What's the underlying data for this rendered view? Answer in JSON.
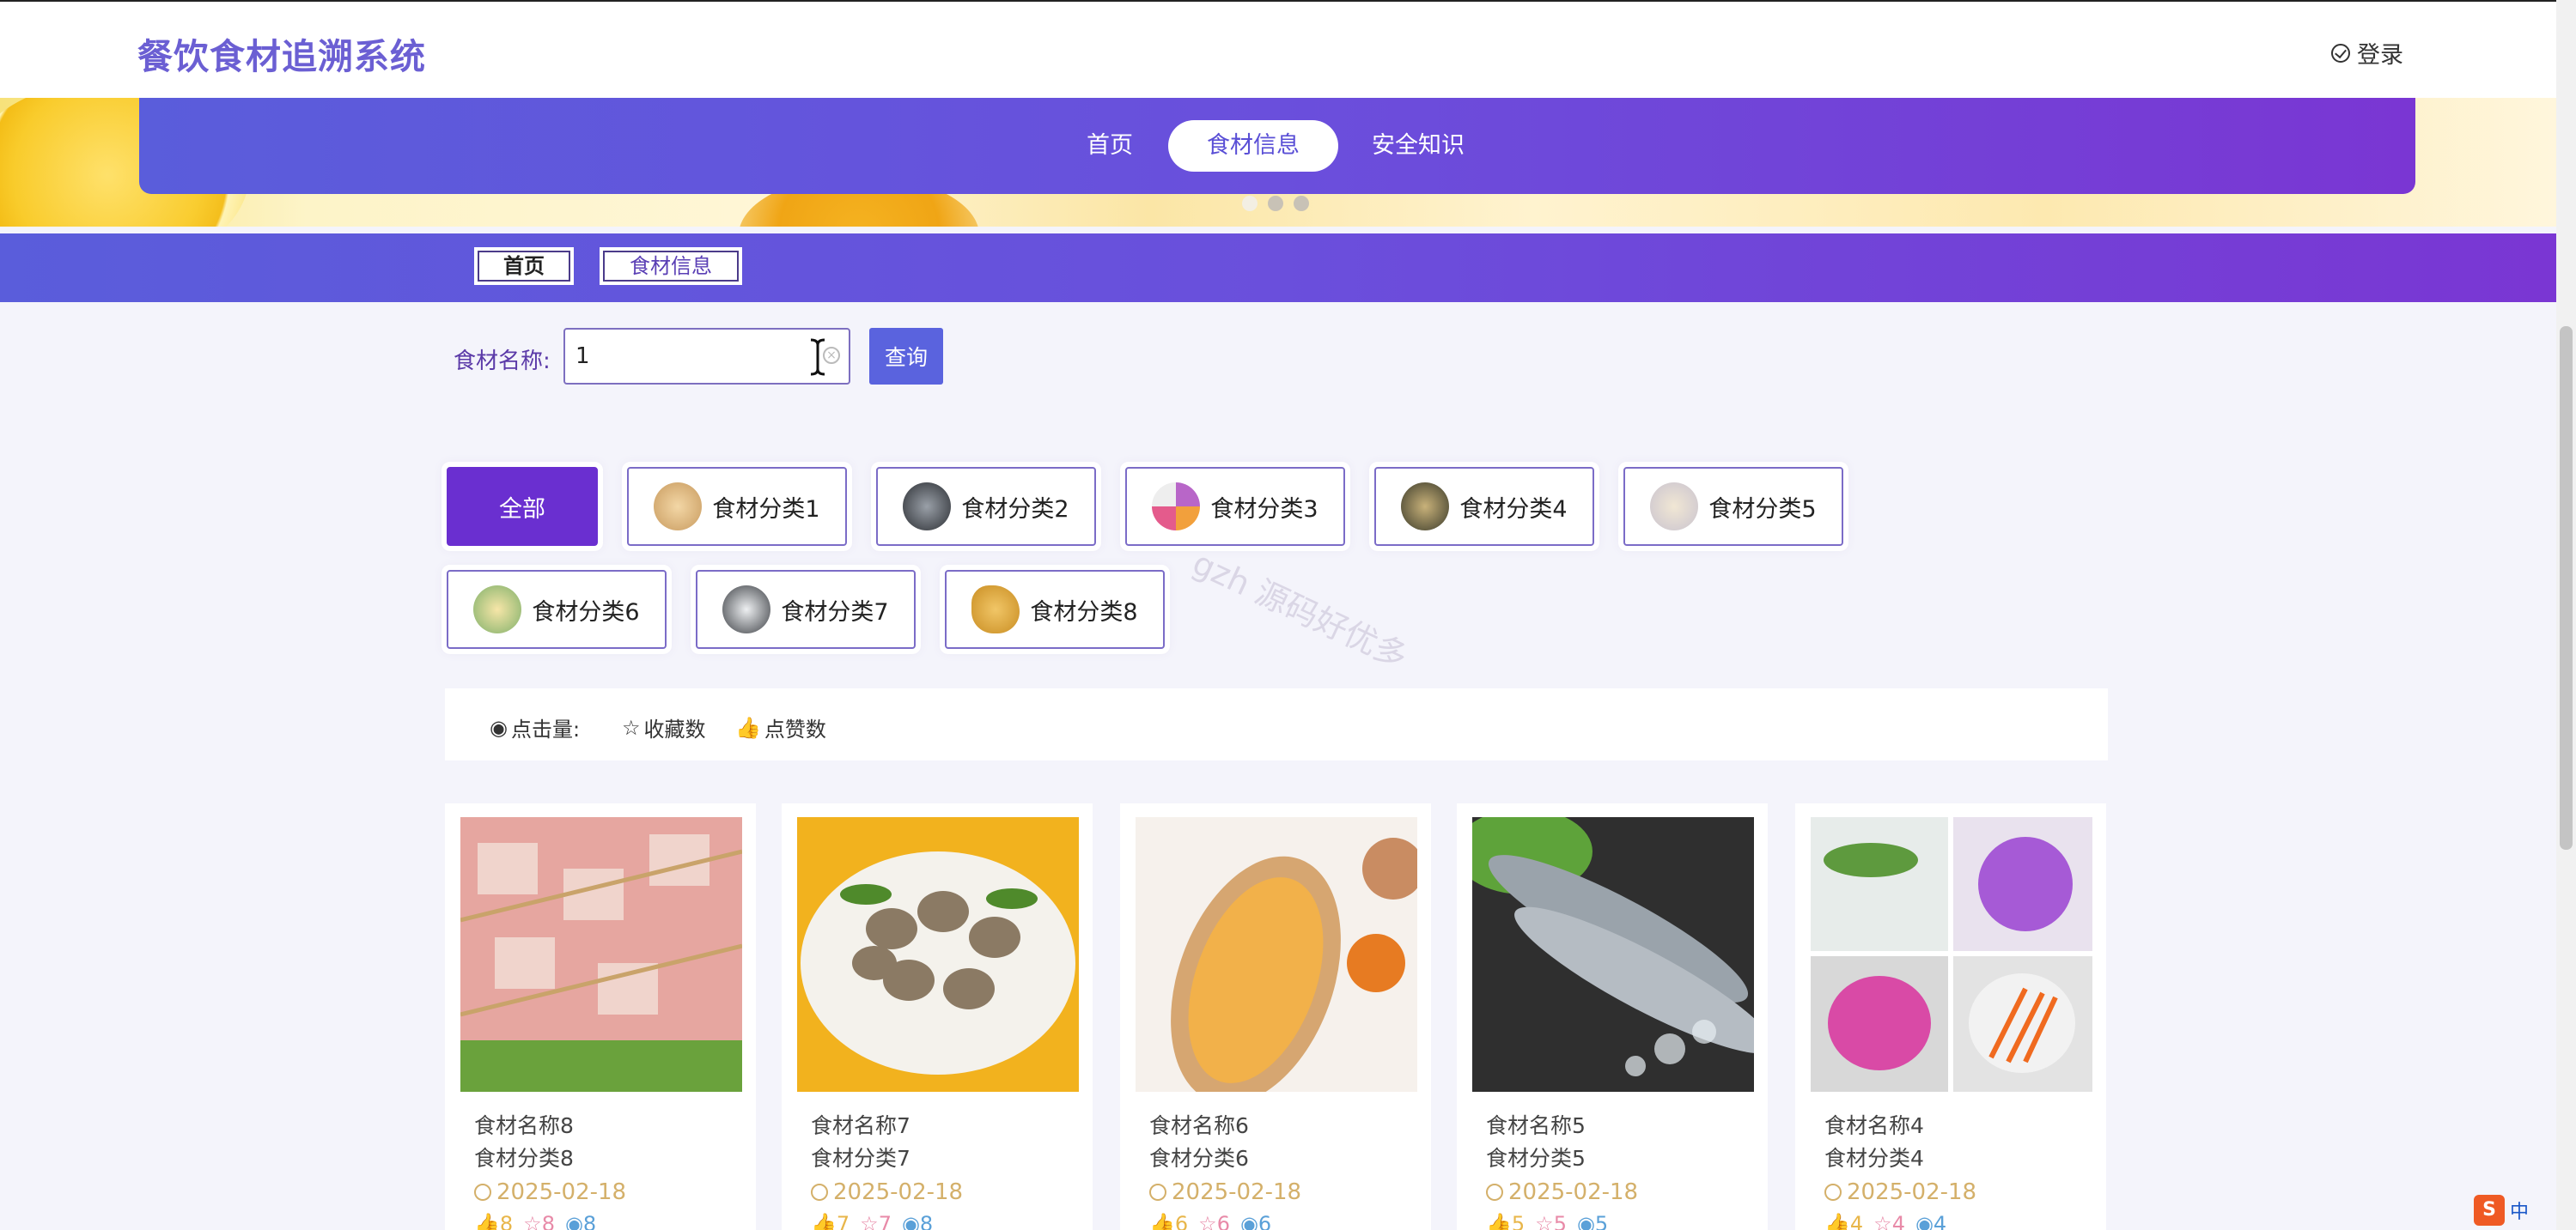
{
  "header": {
    "title": "餐饮食材追溯系统",
    "login": "登录"
  },
  "nav": {
    "items": [
      "首页",
      "食材信息",
      "安全知识"
    ],
    "active": "食材信息"
  },
  "breadcrumb": {
    "home": "首页",
    "current": "食材信息"
  },
  "search": {
    "label": "食材名称:",
    "value": "1",
    "button": "查询"
  },
  "categories": [
    "全部",
    "食材分类1",
    "食材分类2",
    "食材分类3",
    "食材分类4",
    "食材分类5",
    "食材分类6",
    "食材分类7",
    "食材分类8"
  ],
  "watermark": "gzh 源码好优多",
  "sort": {
    "clicks": "点击量:",
    "favorites": "收藏数",
    "likes": "点赞数"
  },
  "products": [
    {
      "name": "食材名称8",
      "category": "食材分类8",
      "date": "2025-02-18",
      "likes": "8",
      "favorites": "8",
      "views": "8"
    },
    {
      "name": "食材名称7",
      "category": "食材分类7",
      "date": "2025-02-18",
      "likes": "7",
      "favorites": "7",
      "views": "8"
    },
    {
      "name": "食材名称6",
      "category": "食材分类6",
      "date": "2025-02-18",
      "likes": "6",
      "favorites": "6",
      "views": "6"
    },
    {
      "name": "食材名称5",
      "category": "食材分类5",
      "date": "2025-02-18",
      "likes": "5",
      "favorites": "5",
      "views": "5"
    },
    {
      "name": "食材名称4",
      "category": "食材分类4",
      "date": "2025-02-18",
      "likes": "4",
      "favorites": "4",
      "views": "4"
    }
  ],
  "ime": {
    "label": "中"
  },
  "colors": {
    "primary": "#5a63de",
    "accent": "#6a2fd0",
    "date": "#d4b06a"
  }
}
